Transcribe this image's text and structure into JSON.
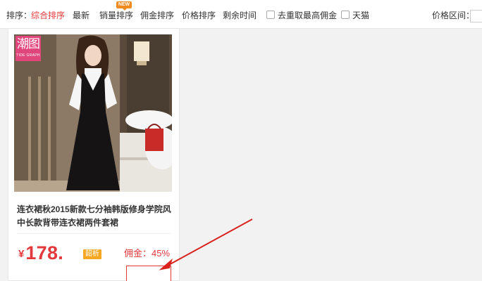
{
  "sort_bar": {
    "label": "排序：",
    "options": [
      {
        "label": "综合排序",
        "active": true
      },
      {
        "label": "最新",
        "active": false
      },
      {
        "label": "销量排序",
        "active": false,
        "badge": "NEW"
      },
      {
        "label": "佣金排序",
        "active": false
      },
      {
        "label": "价格排序",
        "active": false
      },
      {
        "label": "剩余时间",
        "active": false
      }
    ],
    "filters": [
      {
        "label": "去重取最高佣金",
        "checked": false
      },
      {
        "label": "天猫",
        "checked": false
      }
    ],
    "price_range_label": "价格区间："
  },
  "product": {
    "brand_logo_cn": "潮图",
    "brand_logo_en": "TIDE GRAPH",
    "title": "连衣裙秋2015新款七分袖韩版修身学院风中长款背带连衣裙两件套裙",
    "currency_symbol": "¥",
    "price": "178.",
    "discount_tag": "韶析",
    "commission": "佣金：45%"
  },
  "colors": {
    "accent": "#e4393c",
    "badge_orange": "#f08b1e",
    "tag_orange": "#f7a823",
    "logo_pink": "#e0457b"
  }
}
